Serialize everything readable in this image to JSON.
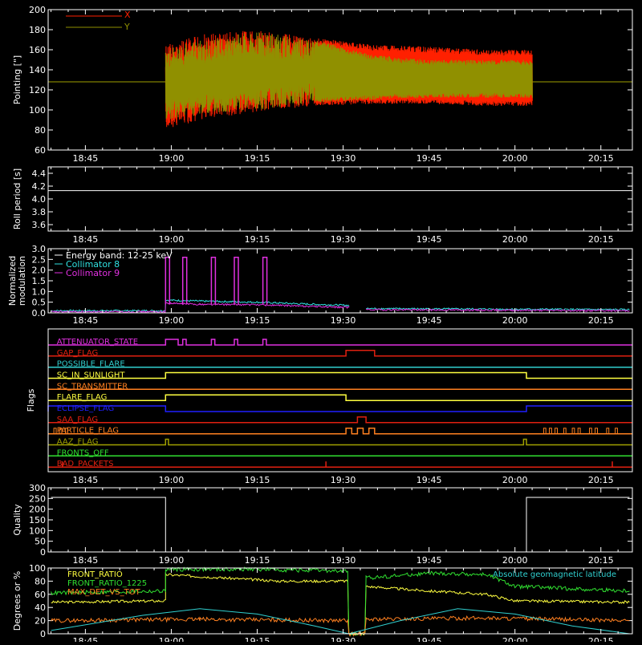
{
  "time_axis": {
    "ticks": [
      "18:45",
      "19:00",
      "19:15",
      "19:30",
      "19:45",
      "20:00",
      "20:15"
    ],
    "tick_minutes": [
      0,
      15,
      30,
      45,
      60,
      75,
      90
    ],
    "range_minutes": [
      -6.5,
      95.5
    ]
  },
  "panels": {
    "pointing": {
      "ylabel": "Pointing [\"]",
      "yticks": [
        "60",
        "80",
        "100",
        "120",
        "140",
        "160",
        "180",
        "200"
      ],
      "ylim": [
        60,
        200
      ],
      "legend": [
        {
          "label": "X",
          "color": "#ff2000"
        },
        {
          "label": "Y",
          "color": "#909000"
        }
      ]
    },
    "roll": {
      "ylabel": "Roll period [s]",
      "yticks": [
        "3.6",
        "3.8",
        "4.0",
        "4.2",
        "4.4"
      ],
      "ylim": [
        3.5,
        4.5
      ]
    },
    "modulation": {
      "ylabel_line1": "Normalized",
      "ylabel_line2": "modulation",
      "yticks": [
        "0.0",
        "0.5",
        "1.0",
        "1.5",
        "2.0",
        "2.5",
        "3.0"
      ],
      "ylim": [
        0,
        3.0
      ],
      "legend": [
        {
          "label": "Energy band: 12-25 keV",
          "color": "#ffffff"
        },
        {
          "label": "Collimator 8",
          "color": "#30e0e0"
        },
        {
          "label": "Collimator 9",
          "color": "#e030e0"
        }
      ]
    },
    "flags": {
      "ylabel": "Flags",
      "items": [
        {
          "label": "ATTENUATOR_STATE",
          "color": "#e030e0"
        },
        {
          "label": "GAP_FLAG",
          "color": "#e02010"
        },
        {
          "label": "POSSIBLE_FLARE",
          "color": "#30d0d0"
        },
        {
          "label": "SC_IN_SUNLIGHT",
          "color": "#ffff40"
        },
        {
          "label": "SC_TRANSMITTER",
          "color": "#ff8020"
        },
        {
          "label": "FLARE_FLAG",
          "color": "#ffff40"
        },
        {
          "label": "ECLIPSE_FLAG",
          "color": "#2020ff"
        },
        {
          "label": "SAA_FLAG",
          "color": "#e02010"
        },
        {
          "label": "PARTICLE_FLAG",
          "color": "#ff8020"
        },
        {
          "label": "AAZ_FLAG",
          "color": "#a0a000"
        },
        {
          "label": "FRONTS_OFF",
          "color": "#30e030"
        },
        {
          "label": "BAD_PACKETS",
          "color": "#e02010"
        }
      ]
    },
    "quality": {
      "ylabel": "Quality",
      "yticks": [
        "0",
        "50",
        "100",
        "150",
        "200",
        "250",
        "300"
      ],
      "ylim": [
        0,
        300
      ]
    },
    "ratios": {
      "ylabel": "Degrees or %",
      "yticks": [
        "0",
        "20",
        "40",
        "60",
        "80",
        "100"
      ],
      "ylim": [
        0,
        100
      ],
      "legend": [
        {
          "label": "FRONT_RATIO",
          "color": "#ffff40"
        },
        {
          "label": "FRONT_RATIO_1225",
          "color": "#30e030"
        },
        {
          "label": "MAX_DET_VS_TOT",
          "color": "#ff8020"
        }
      ],
      "right_legend": {
        "label": "Absolute geomagnetic latitude",
        "color": "#30d0d0"
      }
    }
  },
  "chart_data": [
    {
      "type": "line",
      "title": "",
      "ylabel": "Pointing [\"]",
      "xlabel": "",
      "ylim": [
        60,
        200
      ],
      "x_minutes_from_1845": [
        14,
        20,
        30,
        40,
        50,
        60,
        70,
        78
      ],
      "series": [
        {
          "name": "X",
          "upper": [
            165,
            175,
            180,
            172,
            165,
            163,
            160,
            160
          ],
          "lower": [
            80,
            90,
            98,
            104,
            106,
            106,
            104,
            104
          ]
        },
        {
          "name": "Y",
          "upper": [
            160,
            170,
            178,
            170,
            155,
            150,
            150,
            150
          ],
          "lower": [
            90,
            95,
            100,
            107,
            110,
            112,
            112,
            112
          ]
        }
      ],
      "baseline": 128
    },
    {
      "type": "line",
      "ylabel": "Roll period [s]",
      "ylim": [
        3.5,
        4.5
      ],
      "series": [
        {
          "name": "",
          "constant": 4.13
        }
      ]
    },
    {
      "type": "line",
      "ylabel": "Normalized modulation",
      "ylim": [
        0,
        3.0
      ],
      "series": [
        {
          "name": "Collimator 8",
          "segments": [
            [
              [
                -6,
                0.1
              ],
              [
                14,
                0.1
              ],
              [
                14,
                0.6
              ],
              [
                20,
                0.55
              ],
              [
                30,
                0.5
              ],
              [
                40,
                0.4
              ],
              [
                46,
                0.35
              ]
            ],
            [
              [
                49,
                0.2
              ],
              [
                95,
                0.15
              ]
            ]
          ]
        },
        {
          "name": "Collimator 9",
          "segments": [
            [
              [
                -6,
                0.05
              ],
              [
                14,
                0.05
              ],
              [
                14,
                0.45
              ],
              [
                20,
                0.4
              ],
              [
                30,
                0.38
              ],
              [
                40,
                0.3
              ],
              [
                46,
                0.25
              ]
            ],
            [
              [
                49,
                0.15
              ],
              [
                95,
                0.1
              ]
            ]
          ],
          "spikes_x": [
            14,
            17,
            22,
            26,
            31
          ],
          "spike_value": 2.6
        }
      ]
    },
    {
      "type": "line",
      "ylabel": "Quality",
      "ylim": [
        0,
        300
      ],
      "series": [
        {
          "name": "",
          "points": [
            [
              -6,
              255
            ],
            [
              14,
              255
            ],
            [
              14,
              0
            ],
            [
              77,
              0
            ],
            [
              77,
              255
            ],
            [
              95,
              255
            ]
          ]
        }
      ]
    },
    {
      "type": "line",
      "ylabel": "Degrees or %",
      "ylim": [
        0,
        100
      ],
      "series": [
        {
          "name": "FRONT_RATIO",
          "points": [
            [
              -6,
              48
            ],
            [
              14,
              50
            ],
            [
              14,
              90
            ],
            [
              24,
              85
            ],
            [
              34,
              80
            ],
            [
              46,
              80
            ],
            [
              46,
              0
            ],
            [
              49,
              0
            ],
            [
              49,
              72
            ],
            [
              60,
              65
            ],
            [
              70,
              60
            ],
            [
              75,
              50
            ],
            [
              95,
              48
            ]
          ]
        },
        {
          "name": "FRONT_RATIO_1225",
          "points": [
            [
              -6,
              62
            ],
            [
              14,
              65
            ],
            [
              14,
              98
            ],
            [
              30,
              98
            ],
            [
              46,
              95
            ],
            [
              46,
              0
            ],
            [
              49,
              0
            ],
            [
              49,
              85
            ],
            [
              60,
              92
            ],
            [
              70,
              90
            ],
            [
              75,
              72
            ],
            [
              95,
              65
            ]
          ]
        },
        {
          "name": "MAX_DET_VS_TOT",
          "points": [
            [
              -6,
              20
            ],
            [
              20,
              22
            ],
            [
              46,
              20
            ],
            [
              46,
              0
            ],
            [
              49,
              0
            ],
            [
              49,
              22
            ],
            [
              70,
              24
            ],
            [
              95,
              20
            ]
          ]
        },
        {
          "name": "Absolute geomagnetic latitude",
          "points": [
            [
              -6,
              5
            ],
            [
              10,
              28
            ],
            [
              20,
              38
            ],
            [
              30,
              30
            ],
            [
              40,
              12
            ],
            [
              46,
              0
            ],
            [
              55,
              20
            ],
            [
              65,
              38
            ],
            [
              75,
              30
            ],
            [
              85,
              12
            ],
            [
              95,
              0
            ]
          ]
        }
      ]
    }
  ]
}
